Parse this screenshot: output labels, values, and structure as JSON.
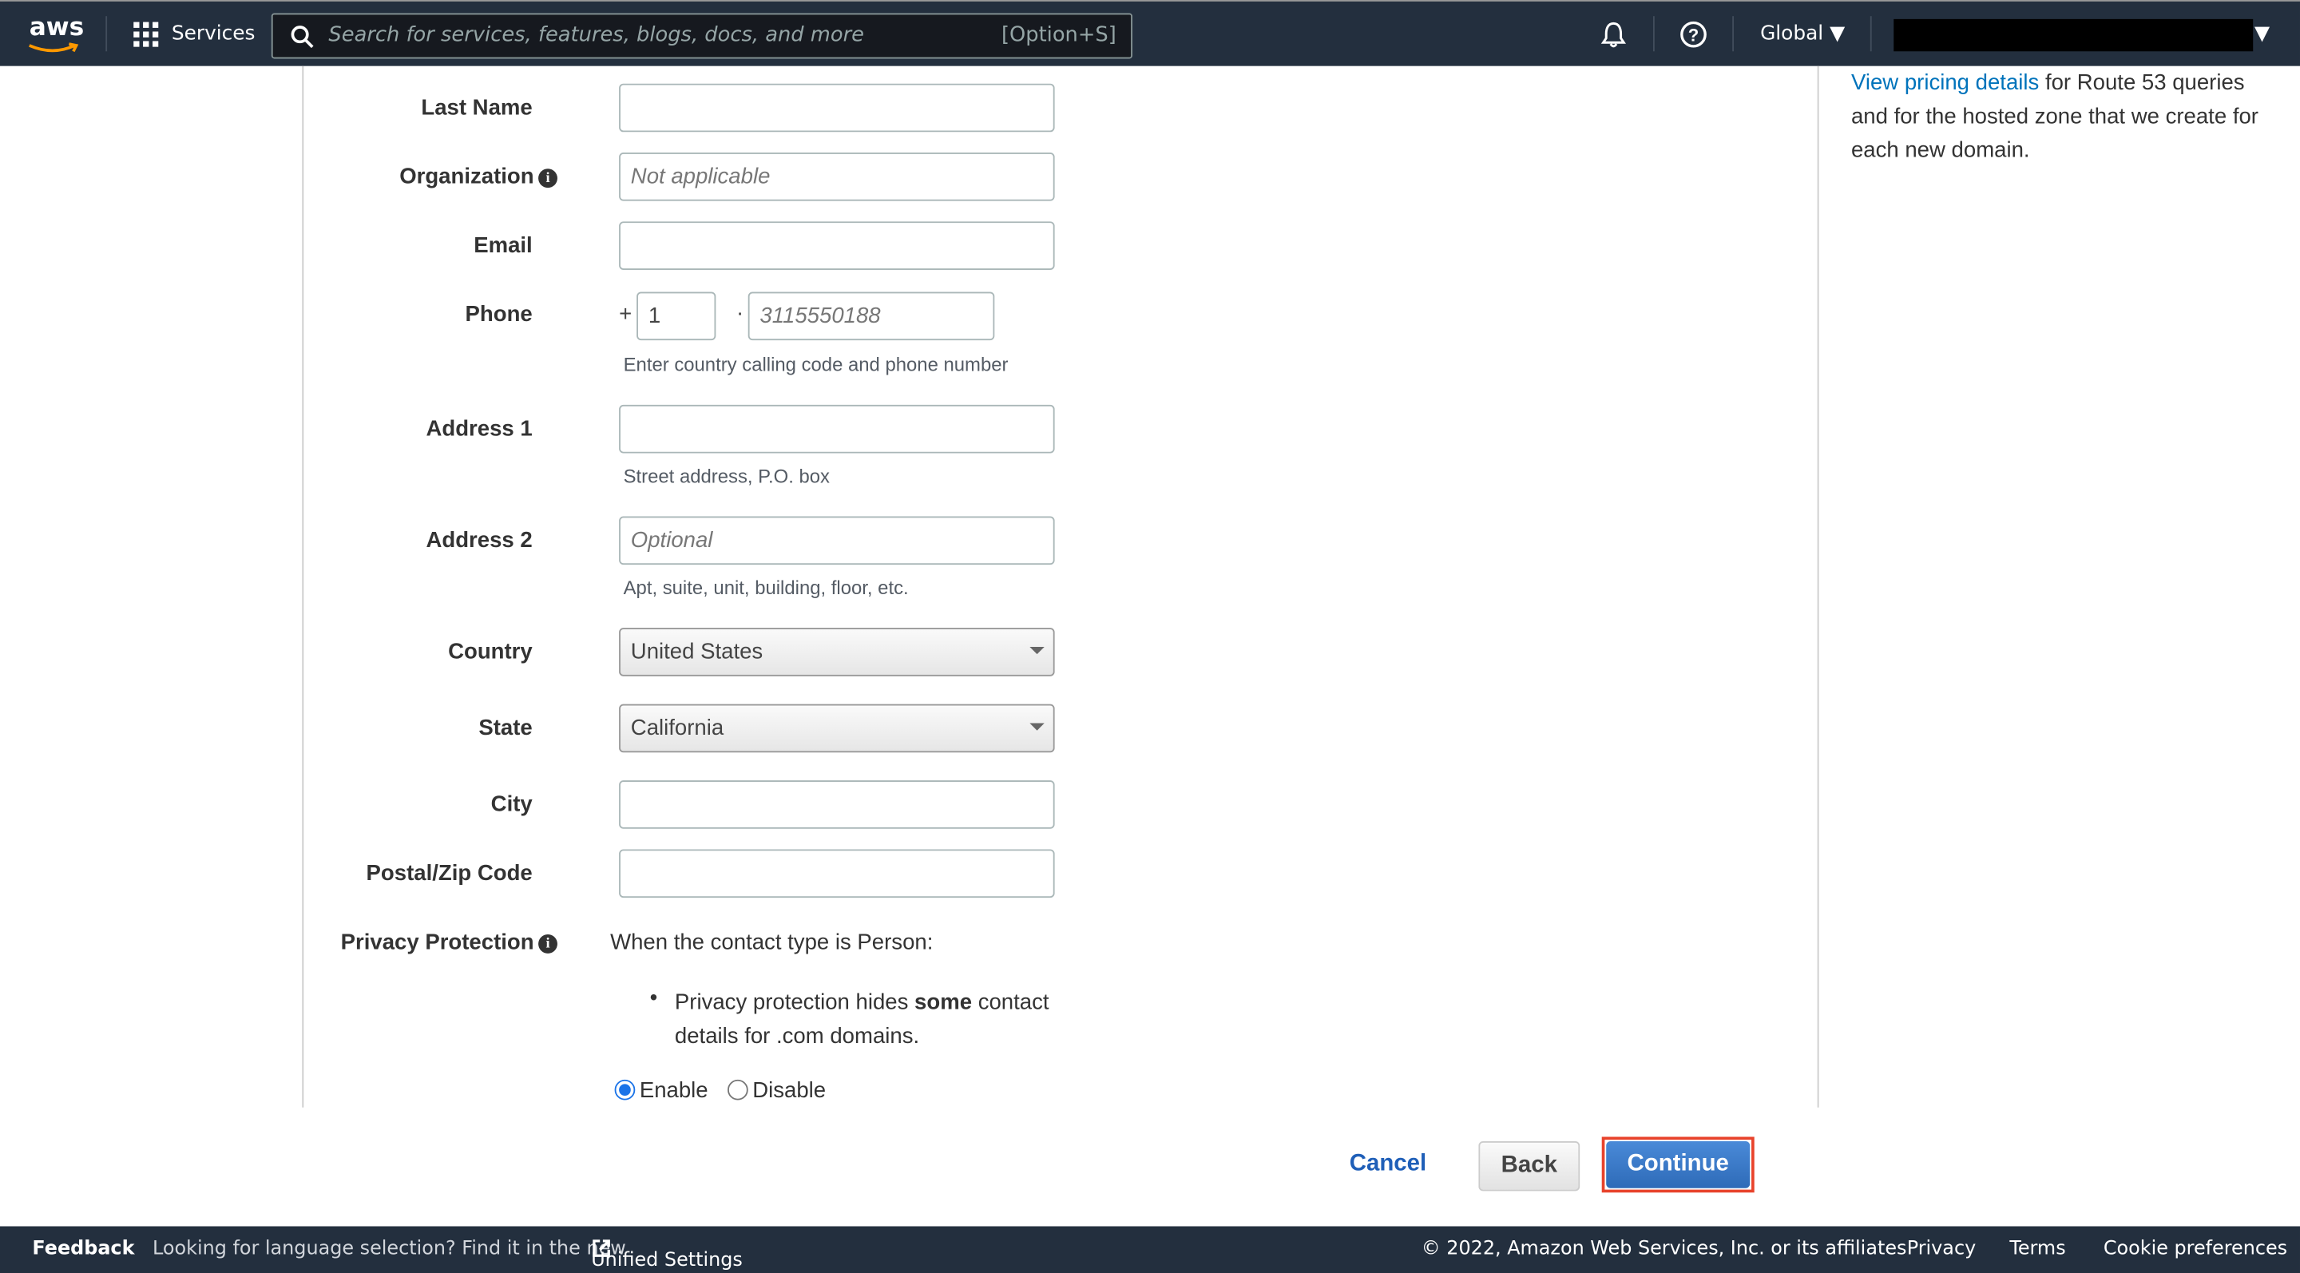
{
  "header": {
    "logo": "aws",
    "services": "Services",
    "search_placeholder": "Search for services, features, blogs, docs, and more",
    "search_shortcut": "[Option+S]",
    "region": "Global",
    "icons": [
      "grid-icon",
      "search-icon",
      "bell-icon",
      "help-icon"
    ]
  },
  "form": {
    "last_name": {
      "label": "Last Name",
      "value": ""
    },
    "organization": {
      "label": "Organization",
      "placeholder": "Not applicable"
    },
    "email": {
      "label": "Email",
      "value": ""
    },
    "phone": {
      "label": "Phone",
      "plus": "+",
      "country_code": "1",
      "sep": "·",
      "placeholder": "3115550188",
      "hint": "Enter country calling code and phone number"
    },
    "address1": {
      "label": "Address 1",
      "hint": "Street address, P.O. box"
    },
    "address2": {
      "label": "Address 2",
      "placeholder": "Optional",
      "hint": "Apt, suite, unit, building, floor, etc."
    },
    "country": {
      "label": "Country",
      "value": "United States"
    },
    "state": {
      "label": "State",
      "value": "California"
    },
    "city": {
      "label": "City",
      "value": ""
    },
    "postal": {
      "label": "Postal/Zip Code",
      "value": ""
    },
    "privacy": {
      "label": "Privacy Protection",
      "intro": "When the contact type is Person:",
      "bullet_pre": "Privacy protection hides ",
      "bullet_bold": "some",
      "bullet_post": " contact",
      "bullet_line2": "details for .com domains.",
      "enable": "Enable",
      "disable": "Disable",
      "selected": "Enable"
    }
  },
  "side": {
    "link": "View pricing details",
    "line1": " for Route 53 queries",
    "line2": "and for the hosted zone that we create for",
    "line3": "each new domain."
  },
  "actions": {
    "cancel": "Cancel",
    "back": "Back",
    "continue": "Continue"
  },
  "footer": {
    "feedback": "Feedback",
    "lang_text": "Looking for language selection? Find it in the new",
    "unified": "Unified Settings",
    "copyright": "© 2022, Amazon Web Services, Inc. or its affiliates.",
    "privacy": "Privacy",
    "terms": "Terms",
    "cookies": "Cookie preferences"
  }
}
